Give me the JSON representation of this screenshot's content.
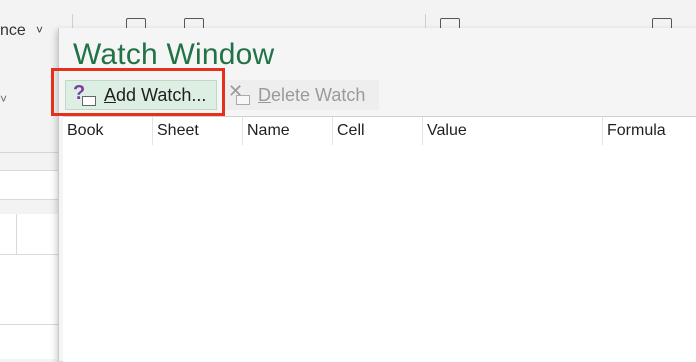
{
  "background": {
    "ribbon_text": "nce",
    "chevron": "˅",
    "small_chevron": "˅"
  },
  "watch_window": {
    "title": "Watch Window",
    "toolbar": {
      "add_watch": {
        "mnemonic": "A",
        "label_rest": "dd Watch...",
        "icon": "add-watch-icon"
      },
      "delete_watch": {
        "mnemonic": "D",
        "label_rest": "elete Watch",
        "icon": "delete-watch-icon"
      }
    },
    "columns": [
      "Book",
      "Sheet",
      "Name",
      "Cell",
      "Value",
      "Formula"
    ]
  },
  "colors": {
    "title": "#217346",
    "highlight_border": "#e3311b",
    "add_watch_bg": "#dcefe2"
  }
}
